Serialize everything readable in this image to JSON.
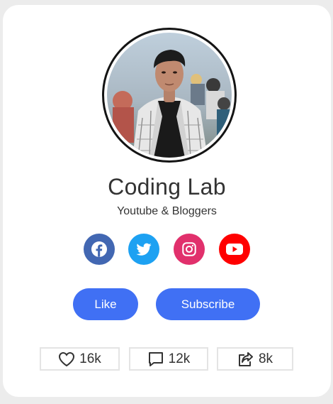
{
  "profile": {
    "name": "Coding Lab",
    "role": "Youtube & Bloggers"
  },
  "social": [
    {
      "icon": "facebook-icon",
      "color": "#4267b2"
    },
    {
      "icon": "twitter-icon",
      "color": "#1da1f2"
    },
    {
      "icon": "instagram-icon",
      "color": "#e1306c"
    },
    {
      "icon": "youtube-icon",
      "color": "#ff0000"
    }
  ],
  "buttons": {
    "like_label": "Like",
    "subscribe_label": "Subscribe",
    "accent": "#4070f4"
  },
  "stats": {
    "likes": "16k",
    "comments": "12k",
    "shares": "8k"
  }
}
